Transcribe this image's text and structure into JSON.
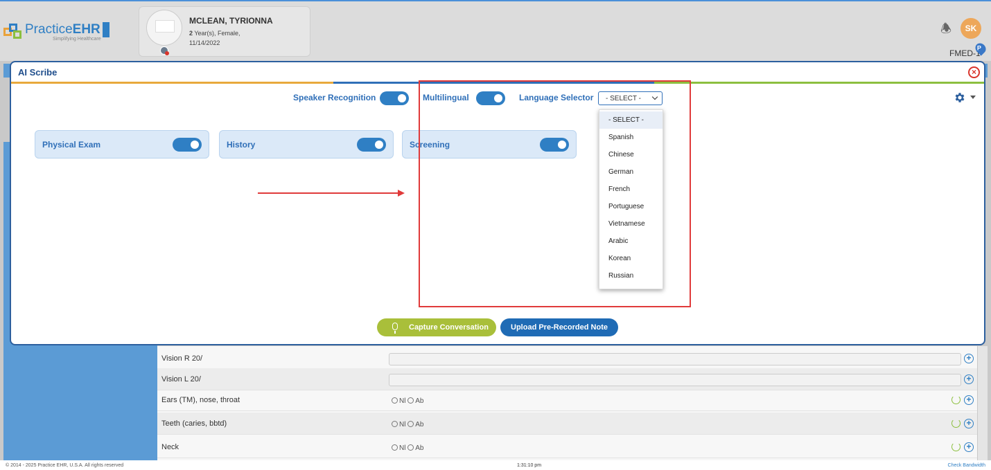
{
  "header": {
    "logo_text_plain": "Practice",
    "logo_text_bold": "EHR",
    "logo_tagline": "Simplifying Healthcare",
    "patient": {
      "name": "MCLEAN, TYRIONNA",
      "age_num": "2",
      "age_rest": " Year(s), Female,",
      "dob": "11/14/2022"
    },
    "user_initials": "SK",
    "facility": "FMED-1"
  },
  "modal": {
    "title": "AI Scribe",
    "speaker_recognition_label": "Speaker Recognition",
    "multilingual_label": "Multilingual",
    "language_selector_label": "Language Selector",
    "language_selected": "- SELECT -",
    "language_options": [
      "- SELECT -",
      "Spanish",
      "Chinese",
      "German",
      "French",
      "Portuguese",
      "Vietnamese",
      "Arabic",
      "Korean",
      "Russian"
    ],
    "sections": [
      "Physical Exam",
      "History",
      "Screening"
    ],
    "capture_button": "Capture Conversation",
    "upload_button": "Upload Pre-Recorded Note"
  },
  "background_rows": [
    {
      "label": "Vision R 20/"
    },
    {
      "label": "Vision L 20/"
    },
    {
      "label": "Ears (TM), nose, throat",
      "nl": "Nl",
      "ab": "Ab"
    },
    {
      "label": "Teeth (caries, bbtd)",
      "nl": "Nl",
      "ab": "Ab"
    },
    {
      "label": "Neck",
      "nl": "Nl",
      "ab": "Ab"
    }
  ],
  "footer": {
    "copyright": "© 2014 - 2025 Practice EHR, U.S.A. All rights reserved",
    "time": "1:31:10 pm",
    "bandwidth": "Check Bandwidth"
  },
  "colors": {
    "accent_blue": "#2f7fc4",
    "modal_border": "#2c5f9e",
    "capture_green": "#a9bf3a",
    "annotation_red": "#e03a3a"
  }
}
